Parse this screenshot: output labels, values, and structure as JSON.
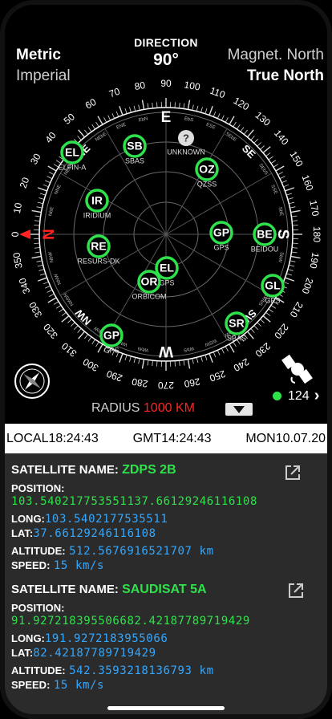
{
  "units": {
    "metric": "Metric",
    "imperial": "Imperial"
  },
  "north": {
    "magnetic": "Magnet. North",
    "true": "True North"
  },
  "direction": {
    "label": "DIRECTION",
    "value": "90°"
  },
  "radar": {
    "cardinals": {
      "n": "N",
      "e": "E",
      "s": "S",
      "w": "W"
    },
    "intercardinals": [
      "NE",
      "SE",
      "SW",
      "NW"
    ],
    "degree_labels": [
      "0",
      "10",
      "20",
      "30",
      "40",
      "50",
      "60",
      "70",
      "80",
      "90",
      "100",
      "110",
      "120",
      "130",
      "140",
      "150",
      "160",
      "170",
      "180",
      "190",
      "200",
      "210",
      "220",
      "230",
      "240",
      "250",
      "260",
      "270",
      "280",
      "290",
      "300",
      "310",
      "320",
      "330",
      "340",
      "350"
    ],
    "minor_labels": [
      "NbE",
      "NNE",
      "NEbN",
      "NEbE",
      "ENE",
      "EbN",
      "EbS",
      "ESE",
      "SEbE",
      "SEbS",
      "SSE",
      "SbE",
      "SbW",
      "SSW",
      "SWbS",
      "SWbW",
      "WSW",
      "WbS",
      "WbN",
      "WNW",
      "NWbW",
      "NWbN",
      "NNW",
      "NbW"
    ],
    "satellites": [
      {
        "code": "EL",
        "label": "ELFIN-A"
      },
      {
        "code": "SB",
        "label": "SBAS"
      },
      {
        "code": "?",
        "label": "UNKNOWN"
      },
      {
        "code": "OZ",
        "label": "QZSS"
      },
      {
        "code": "IR",
        "label": "IRIDIUM"
      },
      {
        "code": "GP",
        "label": "GPS"
      },
      {
        "code": "BE",
        "label": "BEIDOU"
      },
      {
        "code": "RE",
        "label": "RESURS-DK"
      },
      {
        "code": "EL",
        "label": "GPS"
      },
      {
        "code": "OR",
        "label": "ORBICOM"
      },
      {
        "code": "GL",
        "label": "GPS"
      },
      {
        "code": "SR",
        "label": "SBAS"
      },
      {
        "code": "GP",
        "label": "GPS"
      }
    ]
  },
  "count": "124",
  "radius": {
    "label": "RADIUS",
    "value": "1000 KM"
  },
  "time": {
    "local": "LOCAL18:24:43",
    "gmt": "GMT14:24:43",
    "day": "MON10.07.20"
  },
  "details": [
    {
      "name_label": "SATELLITE NAME:",
      "name": "ZDPS 2B",
      "position_label": "POSITION:",
      "position": "103.540217753551137.66129246116108",
      "long_label": "LONG:",
      "long": "103.5402177535511",
      "lat_label": "LAT:",
      "lat": "37.66129246116108",
      "altitude_label": "ALTITUDE:",
      "altitude": "512.5676916521707 km",
      "speed_label": "SPEED:",
      "speed": "15 km/s"
    },
    {
      "name_label": "SATELLITE NAME:",
      "name": "SAUDISAT 5A",
      "position_label": "POSITION:",
      "position": "91.927218395506682.42187789719429",
      "long_label": "LONG:",
      "long": "191.9272183955066",
      "lat_label": "LAT:",
      "lat": "82.42187789719429",
      "altitude_label": "ALTITUDE:",
      "altitude": "542.3593218136793 km",
      "speed_label": "SPEED:",
      "speed": "15 km/s"
    }
  ],
  "colors": {
    "accent_green": "#2ee24b",
    "value_blue": "#33a8ff",
    "radius_red": "#ff2323",
    "north_red": "#ff2323"
  }
}
